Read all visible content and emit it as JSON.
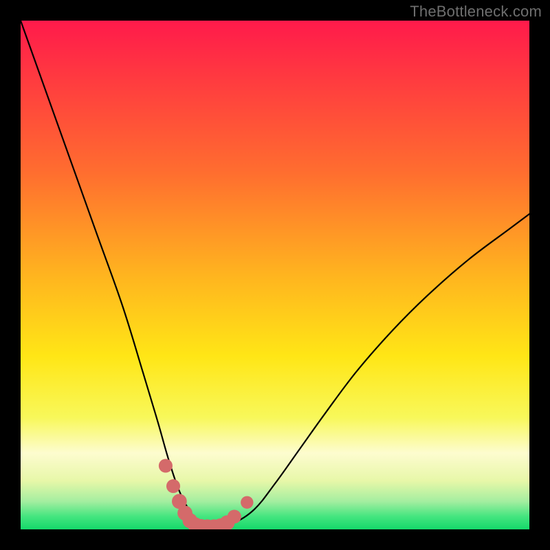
{
  "watermark": "TheBottleneck.com",
  "chart_data": {
    "type": "line",
    "title": "",
    "xlabel": "",
    "ylabel": "",
    "xlim": [
      0,
      100
    ],
    "ylim": [
      0,
      100
    ],
    "grid": false,
    "legend": false,
    "series": [
      {
        "name": "bottleneck-curve",
        "x": [
          0,
          5,
          10,
          15,
          20,
          24,
          27,
          29,
          31,
          33,
          35,
          37,
          39,
          42,
          46,
          50,
          55,
          60,
          66,
          73,
          80,
          88,
          96,
          100
        ],
        "y": [
          100,
          86,
          72,
          58,
          44,
          31,
          21,
          14,
          8,
          4,
          1.5,
          0.6,
          0.6,
          1.3,
          4,
          9,
          16,
          23,
          31,
          39,
          46,
          53,
          59,
          62
        ]
      }
    ],
    "markers": {
      "name": "highlight-dots",
      "color": "#d46a6a",
      "points": [
        {
          "x": 28.5,
          "y": 12.5,
          "r": 1.2
        },
        {
          "x": 30.0,
          "y": 8.5,
          "r": 1.2
        },
        {
          "x": 31.2,
          "y": 5.5,
          "r": 1.4
        },
        {
          "x": 32.3,
          "y": 3.2,
          "r": 1.4
        },
        {
          "x": 33.3,
          "y": 1.7,
          "r": 1.4
        },
        {
          "x": 34.3,
          "y": 0.9,
          "r": 1.4
        },
        {
          "x": 35.5,
          "y": 0.55,
          "r": 1.4
        },
        {
          "x": 36.7,
          "y": 0.5,
          "r": 1.4
        },
        {
          "x": 38.0,
          "y": 0.5,
          "r": 1.4
        },
        {
          "x": 39.3,
          "y": 0.7,
          "r": 1.4
        },
        {
          "x": 40.6,
          "y": 1.3,
          "r": 1.4
        },
        {
          "x": 42.0,
          "y": 2.5,
          "r": 1.2
        },
        {
          "x": 44.5,
          "y": 5.3,
          "r": 1.0
        }
      ]
    },
    "background_gradient_stops": [
      {
        "offset": 0.0,
        "color": "#ff1a4b"
      },
      {
        "offset": 0.12,
        "color": "#ff3c3f"
      },
      {
        "offset": 0.3,
        "color": "#ff6e2f"
      },
      {
        "offset": 0.5,
        "color": "#ffb41f"
      },
      {
        "offset": 0.66,
        "color": "#ffe616"
      },
      {
        "offset": 0.78,
        "color": "#f8f85a"
      },
      {
        "offset": 0.85,
        "color": "#fdfccf"
      },
      {
        "offset": 0.905,
        "color": "#e7f7a8"
      },
      {
        "offset": 0.945,
        "color": "#a4eea0"
      },
      {
        "offset": 0.975,
        "color": "#43e57f"
      },
      {
        "offset": 1.0,
        "color": "#15d96a"
      }
    ]
  }
}
